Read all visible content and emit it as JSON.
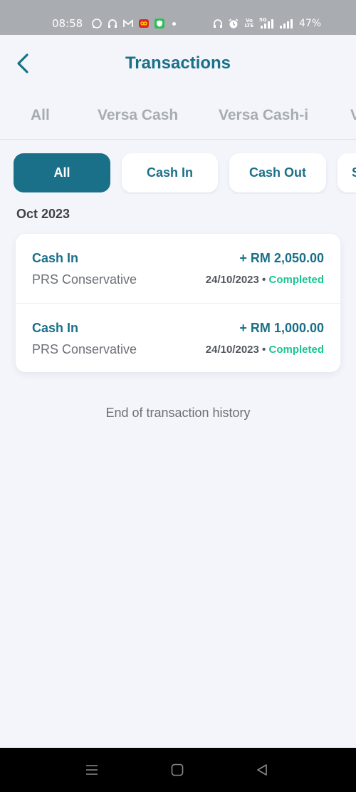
{
  "status_bar": {
    "time": "08:58",
    "battery": "47%",
    "lte_top": "Vo",
    "lte_bottom": "LTE",
    "fiveg": "5G",
    "left_icons": [
      "whatsapp-icon",
      "headphones-icon",
      "gmail-icon",
      "app-badge-icon",
      "shield-app-icon"
    ],
    "right_icons": [
      "headphones-icon",
      "alarm-icon",
      "volte-icon",
      "signal-5g-icon",
      "signal-icon"
    ]
  },
  "header": {
    "title": "Transactions",
    "back_icon": "chevron-left-icon"
  },
  "account_tabs": [
    "All",
    "Versa Cash",
    "Versa Cash-i",
    "V"
  ],
  "filter_chips": [
    "All",
    "Cash In",
    "Cash Out",
    "S"
  ],
  "month": "Oct 2023",
  "transactions": [
    {
      "type": "Cash In",
      "fund": "PRS Conservative",
      "amount": "+ RM 2,050.00",
      "date": "24/10/2023",
      "separator": "•",
      "status": "Completed"
    },
    {
      "type": "Cash In",
      "fund": "PRS Conservative",
      "amount": "+ RM 1,000.00",
      "date": "24/10/2023",
      "separator": "•",
      "status": "Completed"
    }
  ],
  "end_note": "End of transaction history",
  "nav_bar": {
    "icons": [
      "menu-icon",
      "home-square-icon",
      "back-triangle-icon"
    ]
  },
  "colors": {
    "primary": "#1a7088",
    "status_completed": "#1bc592",
    "background": "#f3f5fa"
  }
}
